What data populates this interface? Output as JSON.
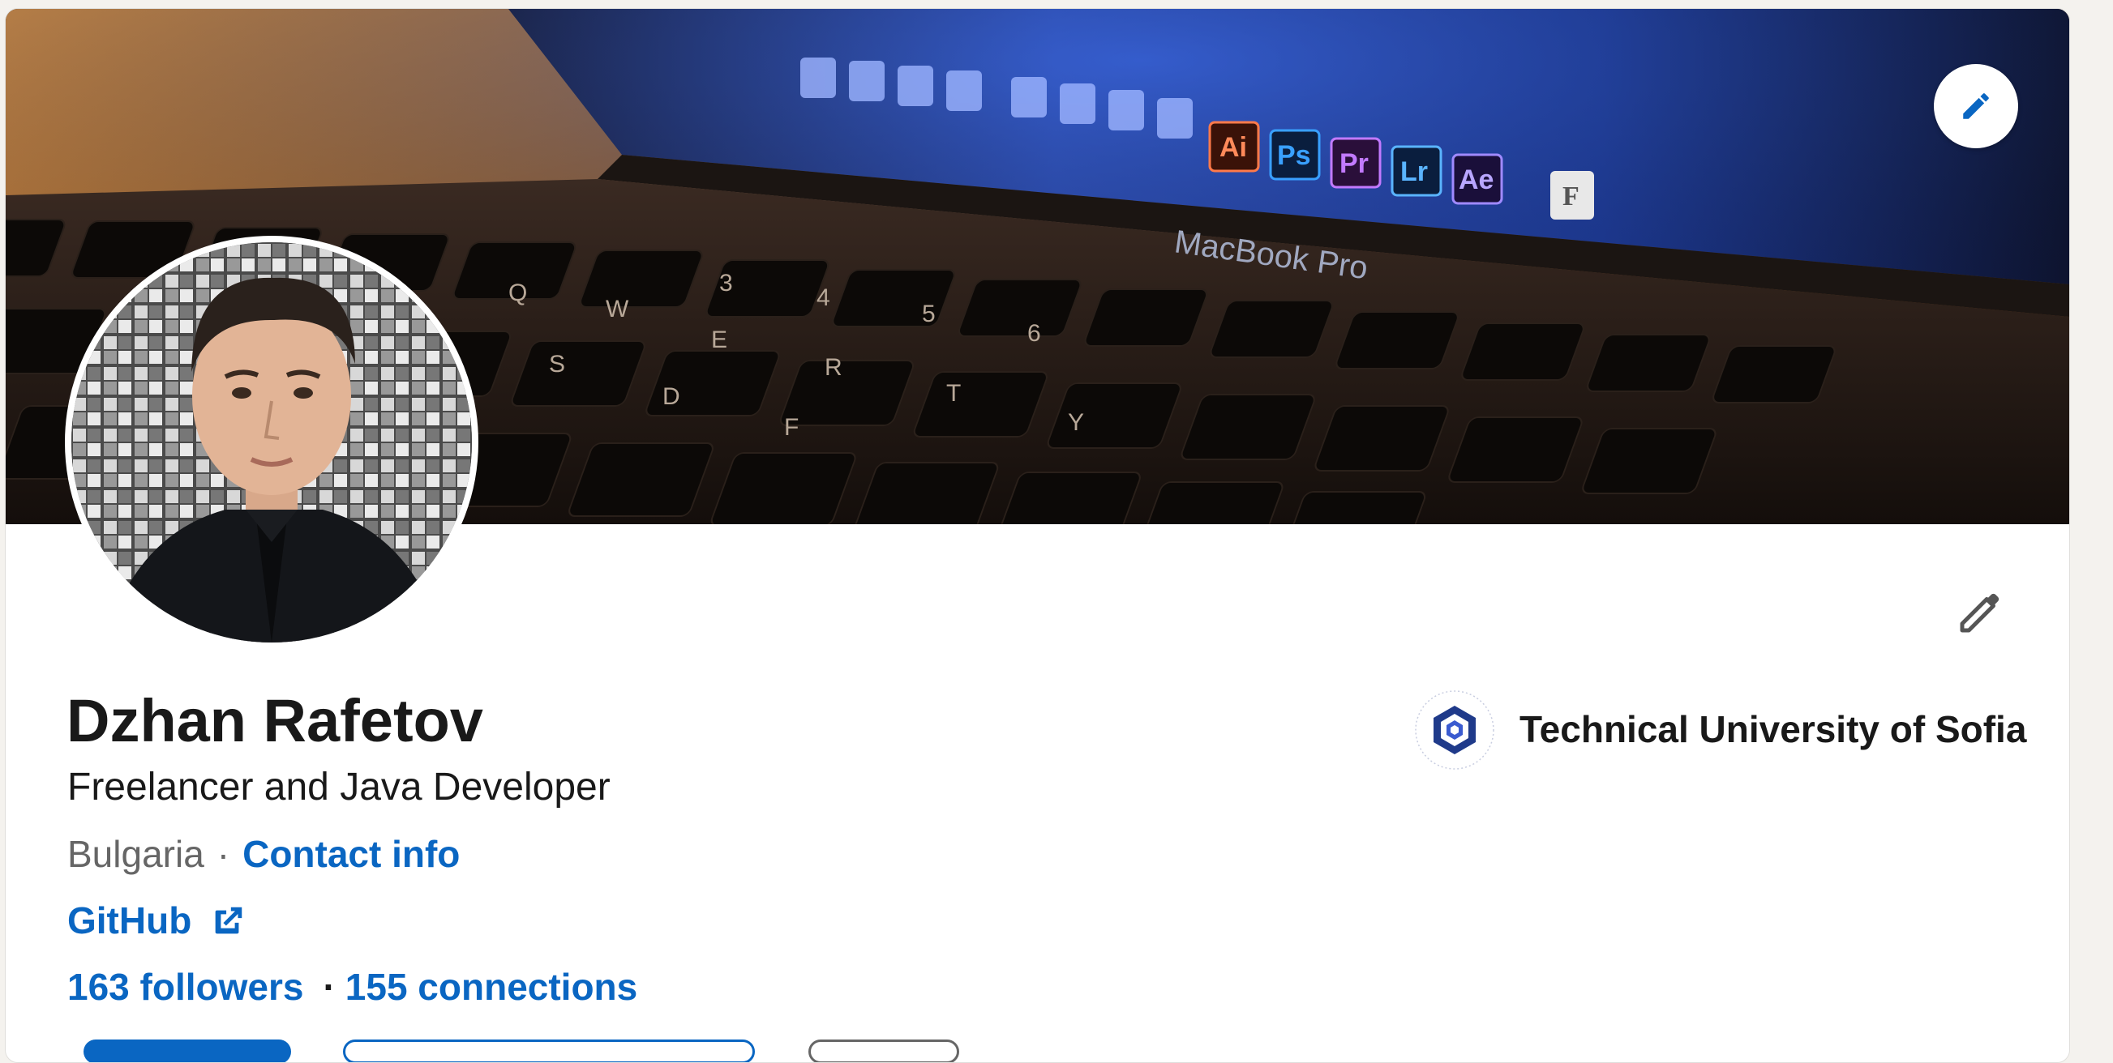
{
  "profile": {
    "name": "Dzhan Rafetov",
    "headline": "Freelancer and Java Developer",
    "location": "Bulgaria",
    "separator": "·",
    "contact_info_label": "Contact info",
    "website_label": "GitHub",
    "followers_label": "163 followers",
    "connections_label": "155 connections"
  },
  "education": {
    "school_name": "Technical University of Sofia"
  },
  "banner": {
    "laptop_label": "MacBook Pro",
    "dock_app_labels": [
      "Ai",
      "Ps",
      "Pr",
      "Lr",
      "Ae",
      "F"
    ],
    "keyboard_keys": [
      "Q",
      "W",
      "E",
      "R",
      "T",
      "Y",
      "S",
      "D",
      "F",
      "3",
      "4",
      "5",
      "6"
    ]
  },
  "icons": {
    "banner_edit": "pencil-icon",
    "intro_edit": "pencil-outline-icon",
    "external_link": "external-link-icon"
  },
  "colors": {
    "link": "#0a66c2",
    "text_primary": "#191919",
    "text_secondary": "#666666",
    "page_bg": "#f4f2ee",
    "card_bg": "#ffffff"
  }
}
